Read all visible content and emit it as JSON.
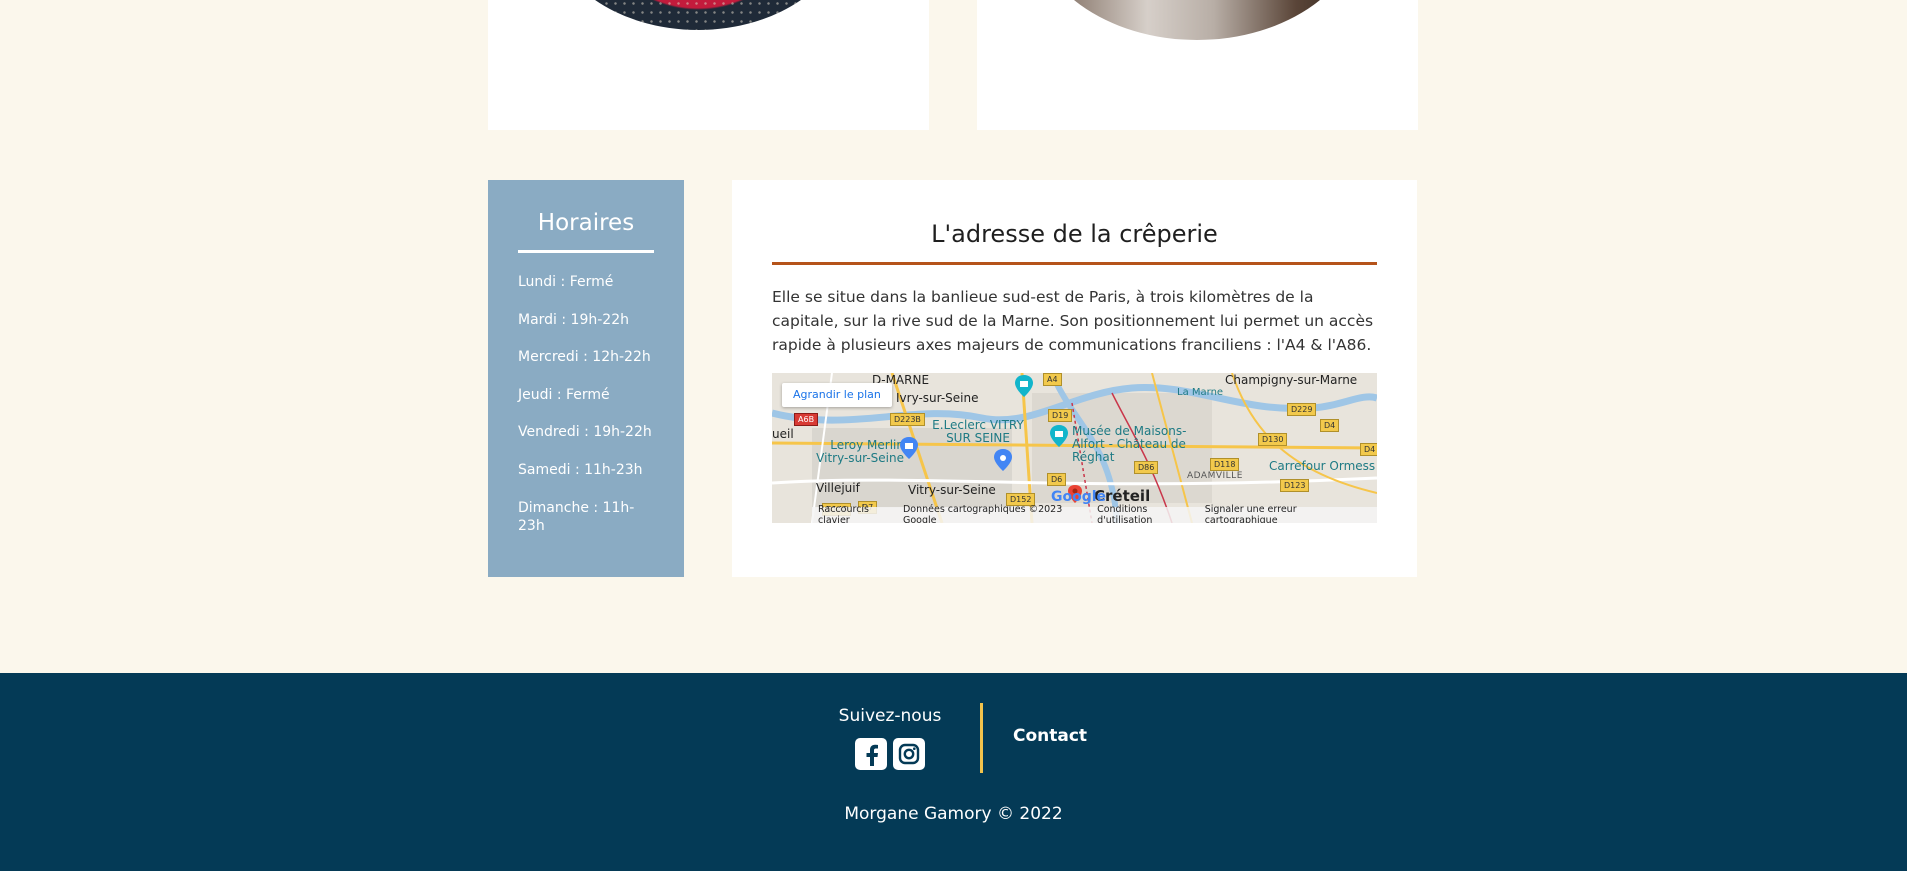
{
  "hours": {
    "title": "Horaires",
    "items": [
      "Lundi : Fermé",
      "Mardi : 19h-22h",
      "Mercredi : 12h-22h",
      "Jeudi : Fermé",
      "Vendredi : 19h-22h",
      "Samedi : 11h-23h",
      "Dimanche : 11h-23h"
    ]
  },
  "address": {
    "title": "L'adresse de la crêperie",
    "description": "Elle se situe dans la banlieue sud-est de Paris, à trois kilomètres de la capitale, sur la rive sud de la Marne. Son positionnement lui permet un accès rapide à plusieurs axes majeurs de communications franciliens : l'A4 & l'A86."
  },
  "map": {
    "enlarge_button": "Agrandir le plan",
    "labels": {
      "marne": "D-MARNE",
      "ivry": "Ivry-sur-Seine",
      "champigny": "Champigny-sur-Marne",
      "la_marne": "La Marne",
      "leclerc": "E.Leclerc VITRY SUR SEINE",
      "musee": "Musée de Maisons-Alfort - Château de Réghat",
      "leroy": "Leroy Merlin Vitry-sur-Seine",
      "villejuif": "Villejuif",
      "vitry": "Vitry-sur-Seine",
      "creteil": "Créteil",
      "adamville": "ADAMVILLE",
      "carrefour": "Carrefour Ormess",
      "ueil": "ueil"
    },
    "shields": [
      "A4",
      "A6B",
      "D223B",
      "D19",
      "D229",
      "D4",
      "D130",
      "D4",
      "D86",
      "D118",
      "D123",
      "D6",
      "D152",
      "D148",
      "D7"
    ],
    "google_logo": "Google",
    "footer": {
      "shortcuts": "Raccourcis clavier",
      "data": "Données cartographiques ©2023 Google",
      "terms": "Conditions d'utilisation",
      "report": "Signaler une erreur cartographique"
    }
  },
  "footer": {
    "follow_label": "Suivez-nous",
    "contact_label": "Contact",
    "copyright": "Morgane Gamory © 2022"
  }
}
